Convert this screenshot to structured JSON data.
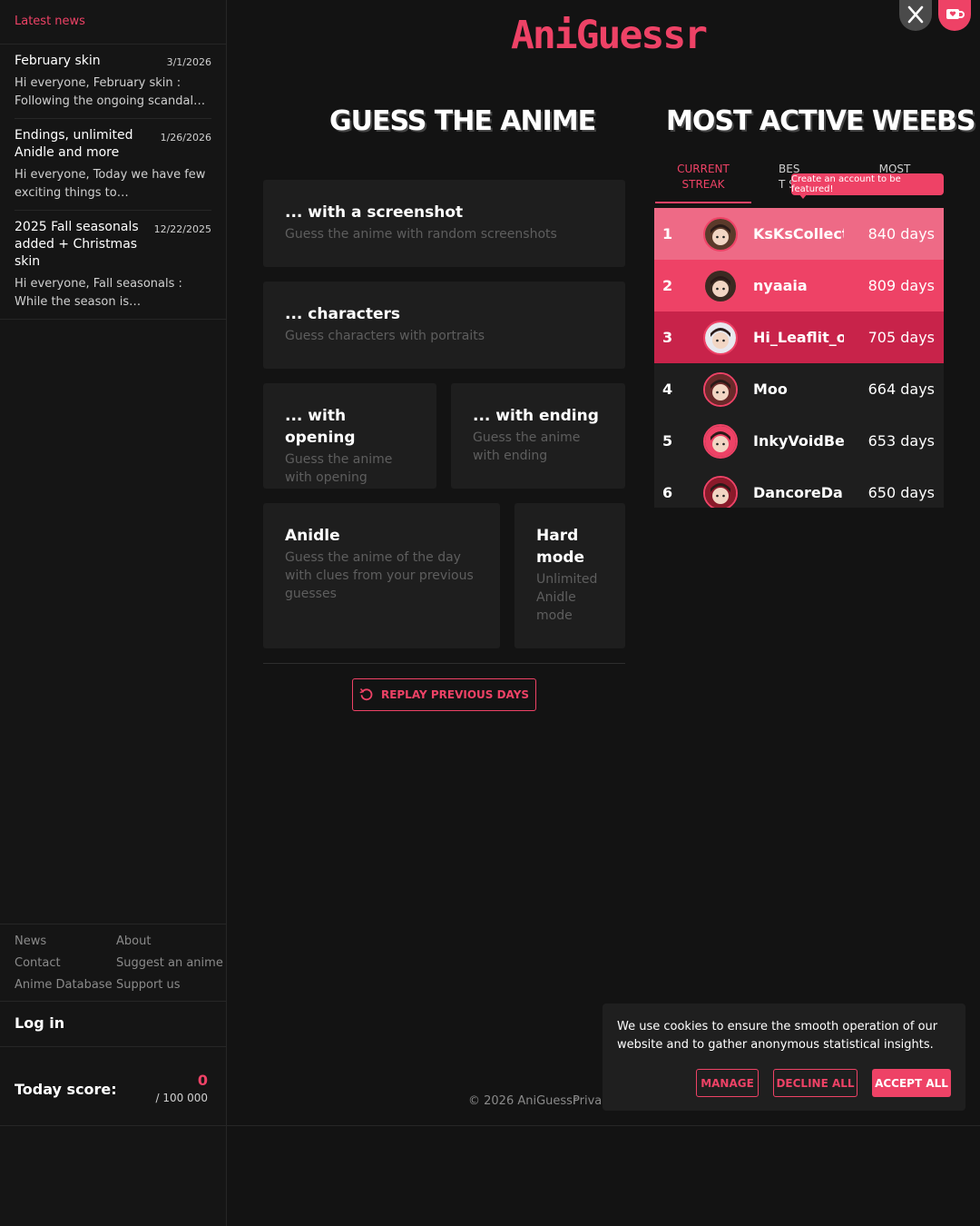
{
  "sidebar": {
    "news_header": "Latest news",
    "news": [
      {
        "title": "February skin",
        "date": "3/1/2026",
        "text": "Hi everyone, February skin : Following the ongoing scandal…"
      },
      {
        "title": "Endings, unlimited Anidle and more",
        "date": "1/26/2026",
        "text": "Hi everyone,  Today we have few exciting things to…"
      },
      {
        "title": "2025 Fall seasonals added + Christmas skin",
        "date": "12/22/2025",
        "text": "Hi everyone,  Fall seasonals : While the season is…"
      }
    ],
    "links": [
      "News",
      "About",
      "Contact",
      "Suggest an anime",
      "Anime Database",
      "Support us"
    ],
    "login": "Log in",
    "score_label": "Today score:",
    "score_value": "0",
    "score_max": "/ 100 000"
  },
  "header": {
    "logo": "AniGuessr",
    "x_icon": "x-logo-icon",
    "kofi_icon": "coffee-cup-icon"
  },
  "modes": {
    "title": "GUESS THE ANIME",
    "cards": [
      {
        "title": "... with a screenshot",
        "desc": "Guess the anime with random screenshots"
      },
      {
        "title": "... characters",
        "desc": "Guess characters with portraits"
      },
      {
        "title": "... with opening",
        "desc": "Guess the anime with opening"
      },
      {
        "title": "... with ending",
        "desc": "Guess the anime with ending"
      },
      {
        "title": "Anidle",
        "desc": "Guess the anime of the day with clues from your previous guesses"
      },
      {
        "title": "Hard mode",
        "desc": "Unlimited Anidle mode"
      }
    ],
    "replay": "REPLAY PREVIOUS DAYS"
  },
  "leaderboard": {
    "title": "MOST ACTIVE WEEBS",
    "tabs": [
      "CURRENT STREAK",
      "BEST ST",
      "MOST"
    ],
    "tooltip": "Create an account to be featured!",
    "rows": [
      {
        "rank": "1",
        "name": "KsKsCollecti",
        "days": "840 days",
        "bg": "#ee6a86"
      },
      {
        "rank": "2",
        "name": "nyaaia",
        "days": "809 days",
        "bg": "#ee4266"
      },
      {
        "rank": "3",
        "name": "Hi_Leaflit_o",
        "days": "705 days",
        "bg": "#c8234a"
      },
      {
        "rank": "4",
        "name": "Moo",
        "days": "664 days",
        "bg": "#1e1e1e"
      },
      {
        "rank": "5",
        "name": "InkyVoidBea",
        "days": "653 days",
        "bg": "#1e1e1e"
      },
      {
        "rank": "6",
        "name": "DancoreDan",
        "days": "650 days",
        "bg": "#1e1e1e"
      }
    ]
  },
  "footer": {
    "copyright": "© 2026 AniGuessr",
    "privacy": "Privacy"
  },
  "cookie": {
    "text": "We use cookies to ensure the smooth operation of our website and to gather anonymous statistical insights.",
    "manage": "MANAGE",
    "decline": "DECLINE ALL",
    "accept": "ACCEPT ALL"
  },
  "colors": {
    "accent": "#ee4266",
    "background": "#131313",
    "card": "#1e1e1e"
  }
}
